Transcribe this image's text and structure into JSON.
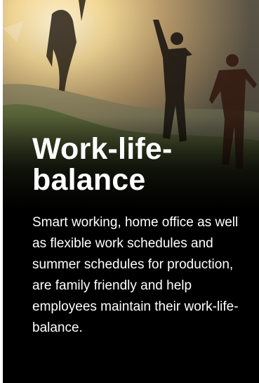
{
  "card": {
    "title": "Work-life-balance",
    "body": "Smart working, home office as well as flexible work schedules and summer schedules for production, are family friendly and help employees maintain their work-life-balance."
  },
  "image": {
    "subject": "silhouettes of people jumping in a sunlit meadow"
  },
  "colors": {
    "background": "#000000",
    "text": "#ffffff",
    "sun": "#f6d38a"
  }
}
